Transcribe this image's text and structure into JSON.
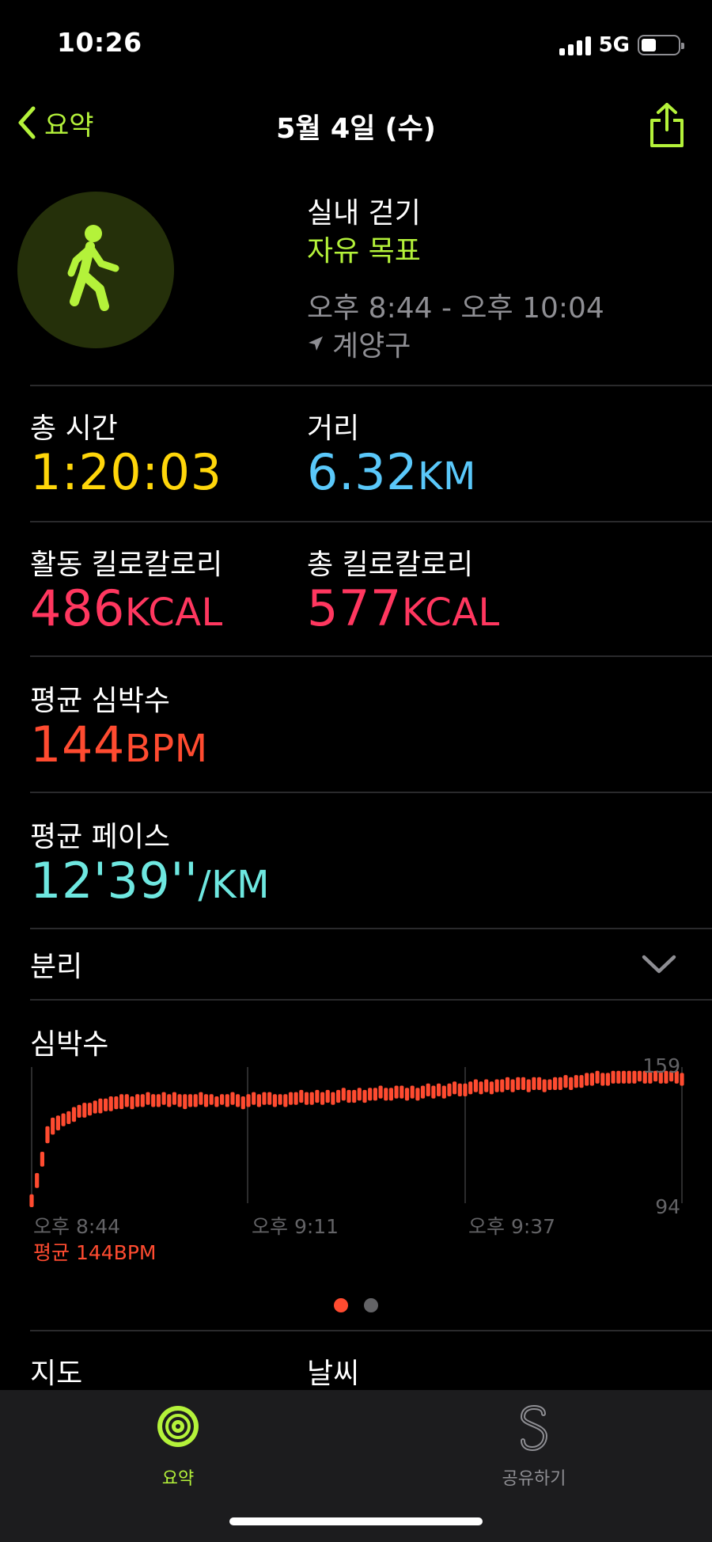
{
  "status_bar": {
    "time": "10:26",
    "network": "5G",
    "battery_level": 0.4
  },
  "nav": {
    "back_label": "요약",
    "title": "5월 4일 (수)"
  },
  "workout": {
    "type": "실내 걷기",
    "goal": "자유 목표",
    "time_range": "오후 8:44 - 오후 10:04",
    "location": "계양구"
  },
  "metrics": {
    "total_time": {
      "label": "총 시간",
      "value": "1:20:03",
      "unit": ""
    },
    "distance": {
      "label": "거리",
      "value": "6.32",
      "unit": "KM"
    },
    "active_kcal": {
      "label": "활동 킬로칼로리",
      "value": "486",
      "unit": "KCAL"
    },
    "total_kcal": {
      "label": "총 킬로칼로리",
      "value": "577",
      "unit": "KCAL"
    },
    "avg_hr": {
      "label": "평균 심박수",
      "value": "144",
      "unit": "BPM"
    },
    "avg_pace": {
      "label": "평균 페이스",
      "value": "12'39''",
      "unit": "/KM"
    }
  },
  "splits": {
    "label": "분리"
  },
  "heart_rate": {
    "title": "심박수",
    "max_label": "159",
    "min_label": "94",
    "time_labels": [
      "오후 8:44",
      "오후 9:11",
      "오후 9:37"
    ],
    "avg_label": "평균 144BPM"
  },
  "chart_data": {
    "type": "bar",
    "title": "심박수",
    "ylim": [
      94,
      159
    ],
    "x_tick_labels": [
      "오후 8:44",
      "오후 9:11",
      "오후 9:37"
    ],
    "bars": [
      [
        94,
        100
      ],
      [
        103,
        110
      ],
      [
        113,
        120
      ],
      [
        124,
        132
      ],
      [
        128,
        136
      ],
      [
        130,
        137
      ],
      [
        132,
        138
      ],
      [
        133,
        139
      ],
      [
        134,
        141
      ],
      [
        136,
        142
      ],
      [
        136,
        143
      ],
      [
        137,
        143
      ],
      [
        138,
        144
      ],
      [
        138,
        145
      ],
      [
        139,
        145
      ],
      [
        139,
        146
      ],
      [
        140,
        146
      ],
      [
        140,
        147
      ],
      [
        141,
        147
      ],
      [
        140,
        146
      ],
      [
        141,
        147
      ],
      [
        141,
        147
      ],
      [
        142,
        148
      ],
      [
        141,
        147
      ],
      [
        141,
        147
      ],
      [
        142,
        148
      ],
      [
        141,
        147
      ],
      [
        142,
        148
      ],
      [
        141,
        147
      ],
      [
        140,
        147
      ],
      [
        141,
        147
      ],
      [
        141,
        147
      ],
      [
        142,
        148
      ],
      [
        141,
        147
      ],
      [
        142,
        147
      ],
      [
        141,
        146
      ],
      [
        142,
        147
      ],
      [
        141,
        147
      ],
      [
        142,
        148
      ],
      [
        141,
        147
      ],
      [
        140,
        146
      ],
      [
        141,
        147
      ],
      [
        142,
        148
      ],
      [
        141,
        147
      ],
      [
        142,
        148
      ],
      [
        142,
        148
      ],
      [
        141,
        147
      ],
      [
        142,
        147
      ],
      [
        141,
        147
      ],
      [
        142,
        148
      ],
      [
        142,
        148
      ],
      [
        143,
        149
      ],
      [
        142,
        148
      ],
      [
        142,
        148
      ],
      [
        143,
        149
      ],
      [
        142,
        148
      ],
      [
        143,
        149
      ],
      [
        142,
        148
      ],
      [
        143,
        149
      ],
      [
        144,
        150
      ],
      [
        143,
        149
      ],
      [
        143,
        149
      ],
      [
        144,
        150
      ],
      [
        143,
        149
      ],
      [
        144,
        150
      ],
      [
        144,
        150
      ],
      [
        145,
        151
      ],
      [
        144,
        150
      ],
      [
        144,
        150
      ],
      [
        145,
        151
      ],
      [
        145,
        151
      ],
      [
        144,
        150
      ],
      [
        145,
        151
      ],
      [
        144,
        150
      ],
      [
        145,
        151
      ],
      [
        146,
        152
      ],
      [
        145,
        151
      ],
      [
        146,
        152
      ],
      [
        145,
        151
      ],
      [
        146,
        152
      ],
      [
        147,
        153
      ],
      [
        146,
        152
      ],
      [
        146,
        152
      ],
      [
        147,
        153
      ],
      [
        148,
        154
      ],
      [
        147,
        153
      ],
      [
        148,
        154
      ],
      [
        147,
        153
      ],
      [
        148,
        154
      ],
      [
        148,
        154
      ],
      [
        149,
        155
      ],
      [
        148,
        154
      ],
      [
        149,
        155
      ],
      [
        149,
        155
      ],
      [
        148,
        154
      ],
      [
        149,
        155
      ],
      [
        149,
        155
      ],
      [
        148,
        154
      ],
      [
        149,
        154
      ],
      [
        149,
        155
      ],
      [
        149,
        155
      ],
      [
        150,
        156
      ],
      [
        149,
        155
      ],
      [
        150,
        156
      ],
      [
        150,
        156
      ],
      [
        151,
        157
      ],
      [
        151,
        157
      ],
      [
        152,
        158
      ],
      [
        151,
        157
      ],
      [
        151,
        157
      ],
      [
        152,
        158
      ],
      [
        152,
        158
      ],
      [
        152,
        158
      ],
      [
        152,
        158
      ],
      [
        152,
        158
      ],
      [
        153,
        158
      ],
      [
        152,
        158
      ],
      [
        152,
        158
      ],
      [
        153,
        158
      ],
      [
        152,
        158
      ],
      [
        152,
        158
      ],
      [
        153,
        158
      ],
      [
        152,
        158
      ],
      [
        151,
        157
      ]
    ]
  },
  "pager": {
    "count": 2,
    "active": 0
  },
  "sections": {
    "map": "지도",
    "weather": "날씨"
  },
  "tabbar": {
    "summary": "요약",
    "sharing": "공유하기"
  },
  "colors": {
    "accent_green": "#b4f23a",
    "time_yellow": "#ffd60a",
    "distance_blue": "#5ac8fa",
    "kcal_pink": "#ff375f",
    "hr_red": "#ff4b30",
    "pace_cyan": "#6ee7e0",
    "secondary_gray": "#8e8e93"
  }
}
